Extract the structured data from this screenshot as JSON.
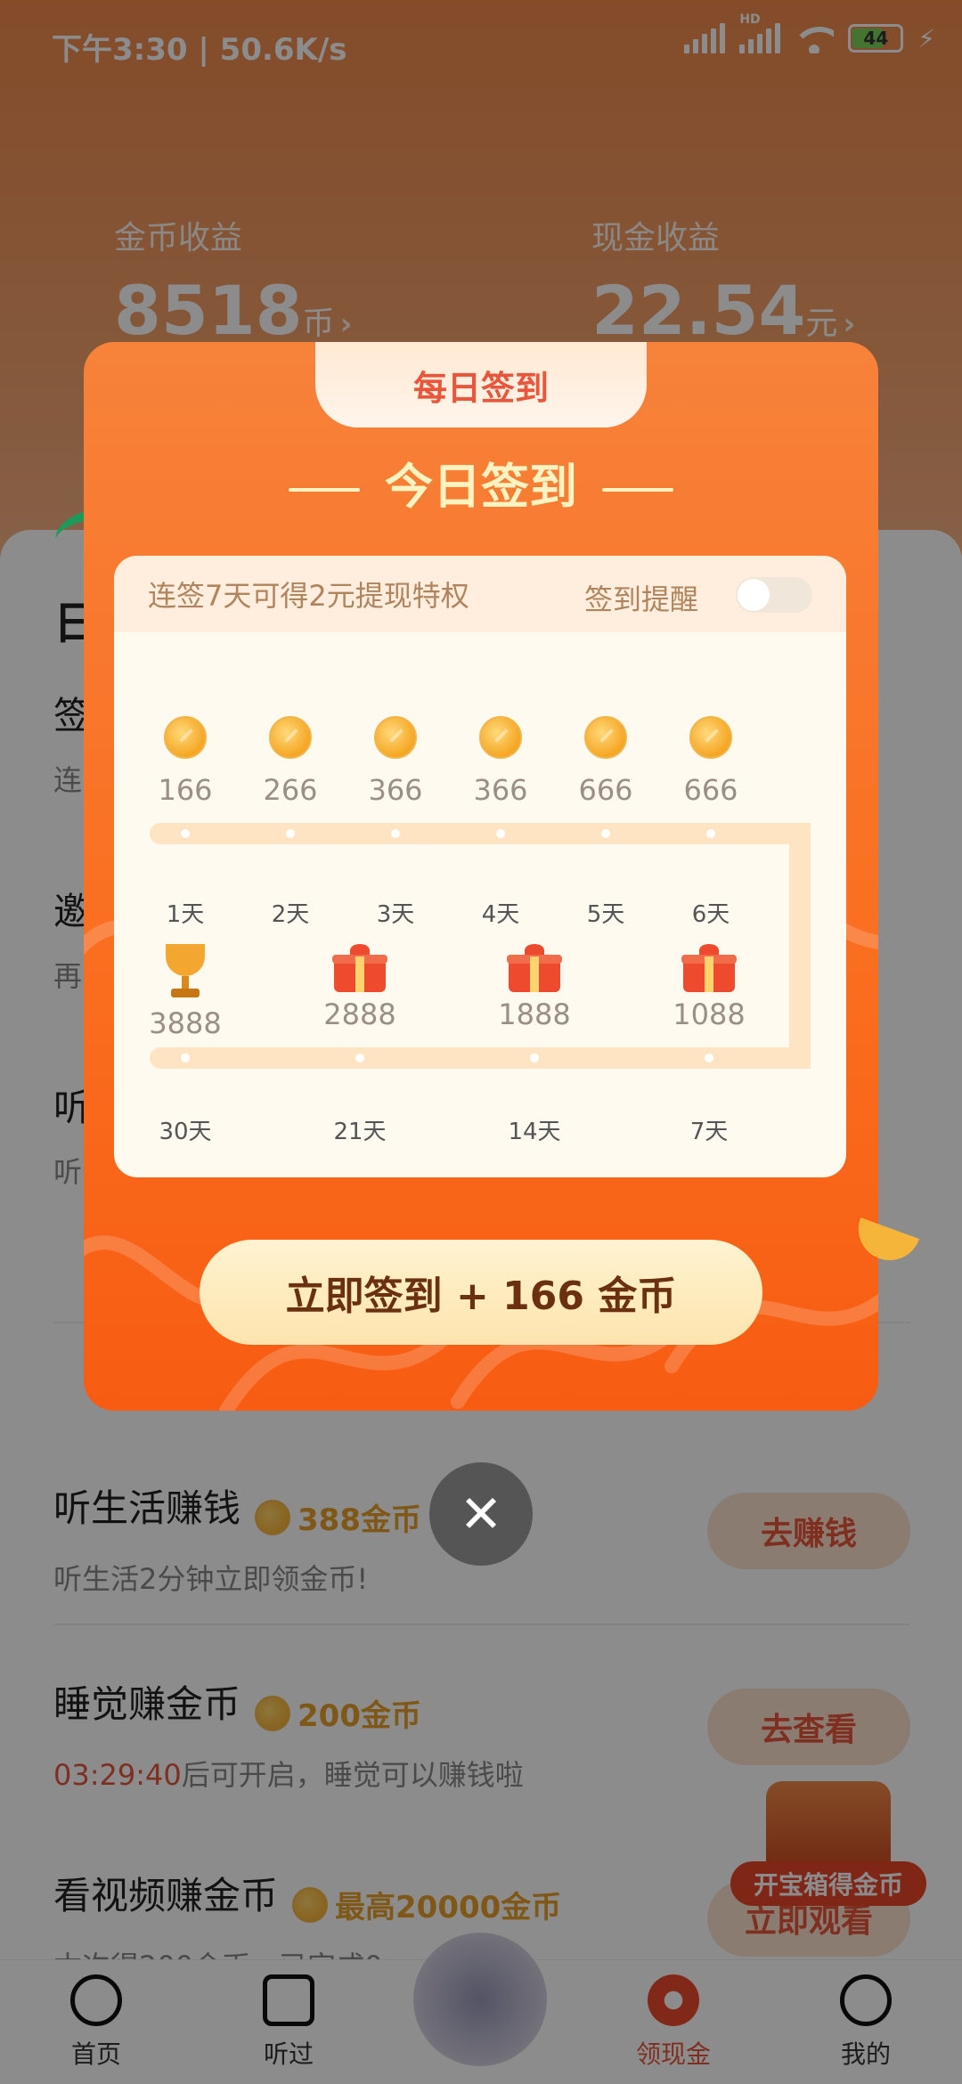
{
  "status_bar": {
    "time_speed": "下午3:30 | 50.6K/s",
    "battery": "44",
    "hd": "HD"
  },
  "earnings": {
    "coin_label": "金币收益",
    "coin_value": "8518",
    "coin_unit": "币",
    "cash_label": "现金收益",
    "cash_value": "22.54",
    "cash_unit": "元"
  },
  "section_title_partial": "日",
  "tasks": [
    {
      "name": "签",
      "desc": "连"
    },
    {
      "name": "邀",
      "desc": "再"
    },
    {
      "name": "听",
      "desc": "听"
    },
    {
      "name": "听生活赚钱",
      "reward": "388金币",
      "desc": "听生活2分钟立即领金币!",
      "button": "去赚钱"
    },
    {
      "name": "睡觉赚金币",
      "reward": "200金币",
      "desc_highlight": "03:29:40",
      "desc": "后可开启，睡觉可以赚钱啦",
      "button": "去查看"
    },
    {
      "name": "看视频赚金币",
      "reward": "最高20000金币",
      "desc": "本次得200金币，已完成0",
      "button": "立即观看"
    }
  ],
  "treasure_label": "开宝箱得金币",
  "tabbar": [
    {
      "label": "首页"
    },
    {
      "label": "听过"
    },
    {
      "label": "领现金",
      "active": true
    },
    {
      "label": "我的"
    }
  ],
  "dialog": {
    "tab_label": "每日签到",
    "title": "今日签到",
    "hint": "连签7天可得2元提现特权",
    "remind_label": "签到提醒",
    "row1": [
      {
        "amount": "166",
        "day": "1天"
      },
      {
        "amount": "266",
        "day": "2天"
      },
      {
        "amount": "366",
        "day": "3天"
      },
      {
        "amount": "366",
        "day": "4天"
      },
      {
        "amount": "666",
        "day": "5天"
      },
      {
        "amount": "666",
        "day": "6天"
      }
    ],
    "row2": [
      {
        "amount": "3888",
        "day": "30天",
        "icon": "trophy"
      },
      {
        "amount": "2888",
        "day": "21天",
        "icon": "gift"
      },
      {
        "amount": "1888",
        "day": "14天",
        "icon": "gift"
      },
      {
        "amount": "1088",
        "day": "7天",
        "icon": "gift"
      }
    ],
    "cta": "立即签到 + 166 金币",
    "close_glyph": "✕"
  },
  "colors": {
    "accent": "#f7823a",
    "brand_red": "#e8563b",
    "coin": "#f5a623"
  }
}
